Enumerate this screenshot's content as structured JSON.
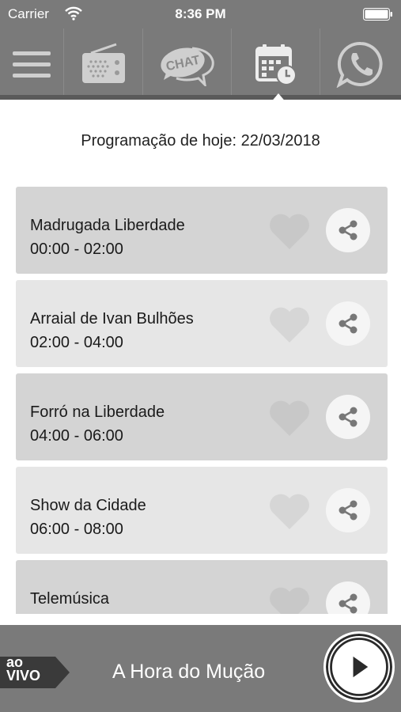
{
  "status": {
    "carrier": "Carrier",
    "time": "8:36 PM"
  },
  "nav": {
    "items": [
      {
        "icon": "menu-icon"
      },
      {
        "icon": "radio-icon"
      },
      {
        "icon": "chat-icon",
        "label": "CHAT"
      },
      {
        "icon": "calendar-icon"
      },
      {
        "icon": "whatsapp-icon"
      }
    ]
  },
  "page": {
    "title": "Programação de hoje: 22/03/2018"
  },
  "schedule": [
    {
      "name": "Madrugada Liberdade",
      "times": "00:00 - 02:00"
    },
    {
      "name": "Arraial de Ivan Bulhões",
      "times": "02:00 - 04:00"
    },
    {
      "name": "Forró na Liberdade",
      "times": "04:00 - 06:00"
    },
    {
      "name": "Show da Cidade",
      "times": "06:00 - 08:00"
    },
    {
      "name": "Telemúsica",
      "times": ""
    }
  ],
  "player": {
    "badge_line1": "ao",
    "badge_line2": "VIVO",
    "now_playing": "A Hora do Mução"
  },
  "colors": {
    "bar": "#7a7a7a",
    "row_dark": "#d4d4d4",
    "row_light": "#e6e6e6",
    "icon": "#c8c8c8"
  }
}
